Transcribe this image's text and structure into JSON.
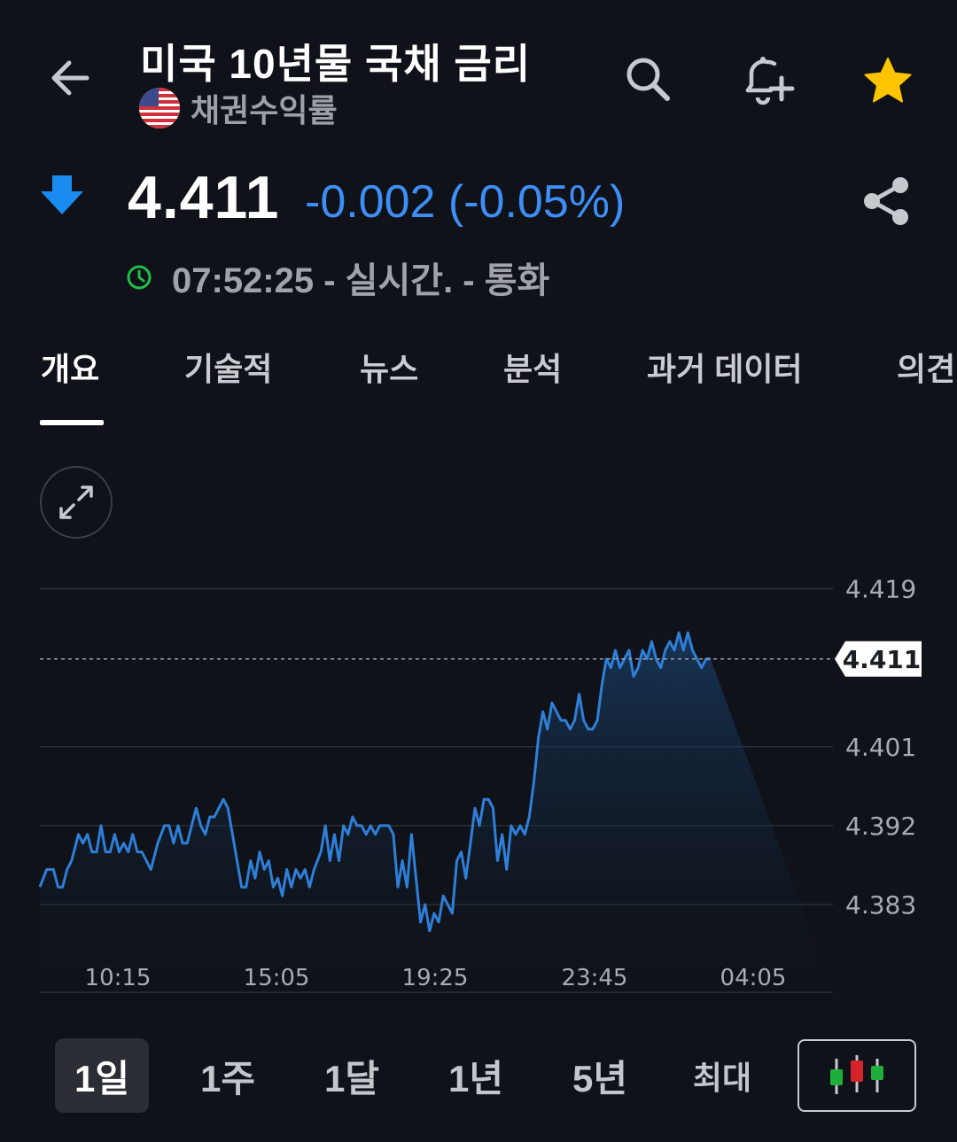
{
  "header": {
    "title": "미국 10년물 국채 금리",
    "subtitle": "채권수익률",
    "icons": [
      "back-arrow-icon",
      "search-icon",
      "add-alert-bell-icon",
      "star-icon"
    ],
    "star_color": "#ffc400"
  },
  "quote": {
    "price": "4.411",
    "change": "-0.002 (-0.05%)",
    "direction_icon": "arrow-down-icon",
    "change_color": "#3e8ef7",
    "time_status": "07:52:25 - 실시간. - 통화"
  },
  "tabs": [
    {
      "label": "개요",
      "active": true
    },
    {
      "label": "기술적",
      "active": false
    },
    {
      "label": "뉴스",
      "active": false
    },
    {
      "label": "분석",
      "active": false
    },
    {
      "label": "과거 데이터",
      "active": false
    },
    {
      "label": "의견",
      "active": false
    }
  ],
  "periods": [
    {
      "label": "1일",
      "active": true
    },
    {
      "label": "1주",
      "active": false
    },
    {
      "label": "1달",
      "active": false
    },
    {
      "label": "1년",
      "active": false
    },
    {
      "label": "5년",
      "active": false
    },
    {
      "label": "최대",
      "active": false
    }
  ],
  "chart_data": {
    "type": "area",
    "line_color": "#2f7fd8",
    "y_ticks": [
      "4.419",
      "4.401",
      "4.392",
      "4.383"
    ],
    "x_ticks": [
      "10:15",
      "15:05",
      "19:25",
      "23:45",
      "04:05"
    ],
    "current_value_label": "4.411",
    "ylim": [
      4.373,
      4.4235
    ],
    "grid": true,
    "x_index": [
      0,
      3,
      6,
      8,
      10,
      12,
      14,
      17,
      19,
      21,
      23,
      25,
      27,
      29,
      31,
      33,
      35,
      37,
      39,
      41,
      43,
      45,
      47,
      49,
      52,
      55,
      57,
      59,
      61,
      63,
      65,
      67,
      69,
      71,
      73,
      75,
      77,
      79,
      81,
      83,
      85,
      87,
      89,
      91,
      93,
      95,
      97,
      99,
      101,
      103,
      105,
      107,
      109,
      111,
      113,
      115,
      117,
      119,
      121,
      124,
      126,
      128,
      130,
      132,
      134,
      136,
      138,
      140,
      142,
      144,
      146,
      148,
      150,
      152,
      154,
      156,
      158,
      160,
      162,
      164,
      166,
      168,
      170,
      172,
      174,
      176,
      178,
      180,
      182,
      184,
      186,
      188,
      190,
      192,
      194,
      196,
      198,
      200,
      202,
      204,
      206,
      208,
      210,
      212,
      214,
      216,
      218,
      220,
      222,
      224,
      226,
      228,
      230,
      232,
      234,
      236,
      238,
      240,
      242,
      244,
      246,
      248,
      250,
      252,
      254,
      256,
      258,
      260,
      262,
      264,
      266,
      268,
      270,
      272,
      274,
      276,
      278,
      280,
      282,
      284,
      286,
      288,
      290,
      292,
      294,
      296,
      298,
      300,
      302,
      304,
      306,
      308,
      310,
      312,
      314,
      316,
      318,
      320,
      322,
      324,
      326,
      328,
      330,
      332,
      334,
      336,
      338,
      340,
      342,
      344,
      346,
      348,
      350
    ],
    "values": [
      4.385,
      4.387,
      4.387,
      4.385,
      4.385,
      4.387,
      4.388,
      4.391,
      4.39,
      4.391,
      4.389,
      4.389,
      4.392,
      4.389,
      4.389,
      4.391,
      4.389,
      4.39,
      4.389,
      4.391,
      4.389,
      4.389,
      4.388,
      4.387,
      4.39,
      4.392,
      4.392,
      4.39,
      4.392,
      4.39,
      4.39,
      4.392,
      4.394,
      4.392,
      4.391,
      4.393,
      4.393,
      4.394,
      4.395,
      4.394,
      4.391,
      4.388,
      4.385,
      4.385,
      4.388,
      4.386,
      4.389,
      4.387,
      4.388,
      4.385,
      4.386,
      4.384,
      4.387,
      4.385,
      4.387,
      4.386,
      4.387,
      4.385,
      4.387,
      4.389,
      4.392,
      4.388,
      4.391,
      4.388,
      4.392,
      4.391,
      4.393,
      4.392,
      4.392,
      4.391,
      4.392,
      4.391,
      4.392,
      4.392,
      4.392,
      4.391,
      4.385,
      4.388,
      4.385,
      4.391,
      4.386,
      4.381,
      4.383,
      4.38,
      4.382,
      4.381,
      4.384,
      4.383,
      4.382,
      4.388,
      4.389,
      4.386,
      4.39,
      4.394,
      4.392,
      4.395,
      4.395,
      4.394,
      4.388,
      4.391,
      4.387,
      4.392,
      4.391,
      4.392,
      4.391,
      4.393,
      4.397,
      4.402,
      4.405,
      4.403,
      4.406,
      4.405,
      4.404,
      4.404,
      4.403,
      4.404,
      4.407,
      4.404,
      4.403,
      4.403,
      4.404,
      4.408,
      4.411,
      4.41,
      4.412,
      4.41,
      4.411,
      4.412,
      4.409,
      4.41,
      4.412,
      4.411,
      4.413,
      4.411,
      4.41,
      4.412,
      4.413,
      4.412,
      4.414,
      4.412,
      4.414,
      4.412,
      4.411,
      4.41,
      4.411,
      4.411
    ]
  }
}
